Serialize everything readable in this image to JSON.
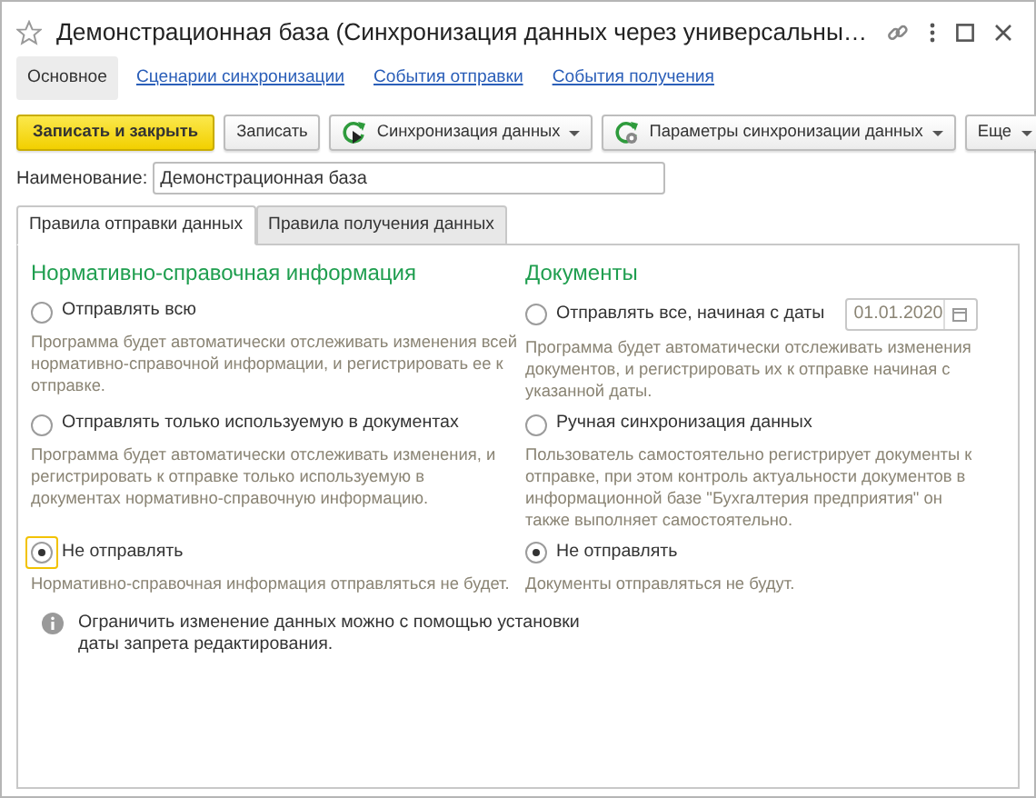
{
  "window": {
    "title": "Демонстрационная база (Синхронизация данных через универсальны…"
  },
  "nav_tabs": [
    {
      "label": "Основное",
      "selected": true
    },
    {
      "label": "Сценарии синхронизации",
      "selected": false
    },
    {
      "label": "События отправки",
      "selected": false
    },
    {
      "label": "События получения",
      "selected": false
    }
  ],
  "toolbar": [
    {
      "kind": "primary",
      "label": "Записать и закрыть"
    },
    {
      "kind": "plain",
      "label": "Записать"
    },
    {
      "kind": "sync",
      "label": "Синхронизация данных"
    },
    {
      "kind": "settings",
      "label": "Параметры синхронизации данных"
    },
    {
      "kind": "more",
      "label": "Еще"
    }
  ],
  "name_field": {
    "label": "Наименование:",
    "value": "Демонстрационная база"
  },
  "tabs": [
    {
      "label": "Правила отправки данных",
      "selected": true
    },
    {
      "label": "Правила получения данных",
      "selected": false
    }
  ],
  "sections": [
    {
      "title": "Нормативно-справочная информация",
      "options": [
        {
          "label": "Отправлять всю",
          "selected": false,
          "focused": false,
          "description": "Программа будет автоматически отслеживать изменения всей нормативно-справочной информации, и регистрировать ее к отправке."
        },
        {
          "label": "Отправлять только используемую в документах",
          "selected": false,
          "focused": false,
          "description": "Программа будет автоматически отслеживать изменения, и регистрировать к отправке только используемую в документах нормативно-справочную информацию."
        },
        {
          "label": "Не отправлять",
          "selected": true,
          "focused": true,
          "description": "Нормативно-справочная информация отправляться не будет."
        }
      ]
    },
    {
      "title": "Документы",
      "options": [
        {
          "label": "Отправлять все, начиная с даты",
          "selected": false,
          "focused": false,
          "date": "01.01.2020",
          "description": "Программа будет автоматически отслеживать изменения документов, и регистрировать их к отправке начиная с указанной даты."
        },
        {
          "label": "Ручная синхронизация данных",
          "selected": false,
          "focused": false,
          "description": "Пользователь самостоятельно регистрирует документы к отправке, при этом контроль актуальности документов в информационной базе \"Бухгалтерия предприятия\" он также выполняет самостоятельно."
        },
        {
          "label": "Не отправлять",
          "selected": true,
          "focused": false,
          "description": "Документы отправляться не будут."
        }
      ]
    }
  ],
  "info_note": "Ограничить изменение данных можно с помощью установки даты запрета редактирования."
}
